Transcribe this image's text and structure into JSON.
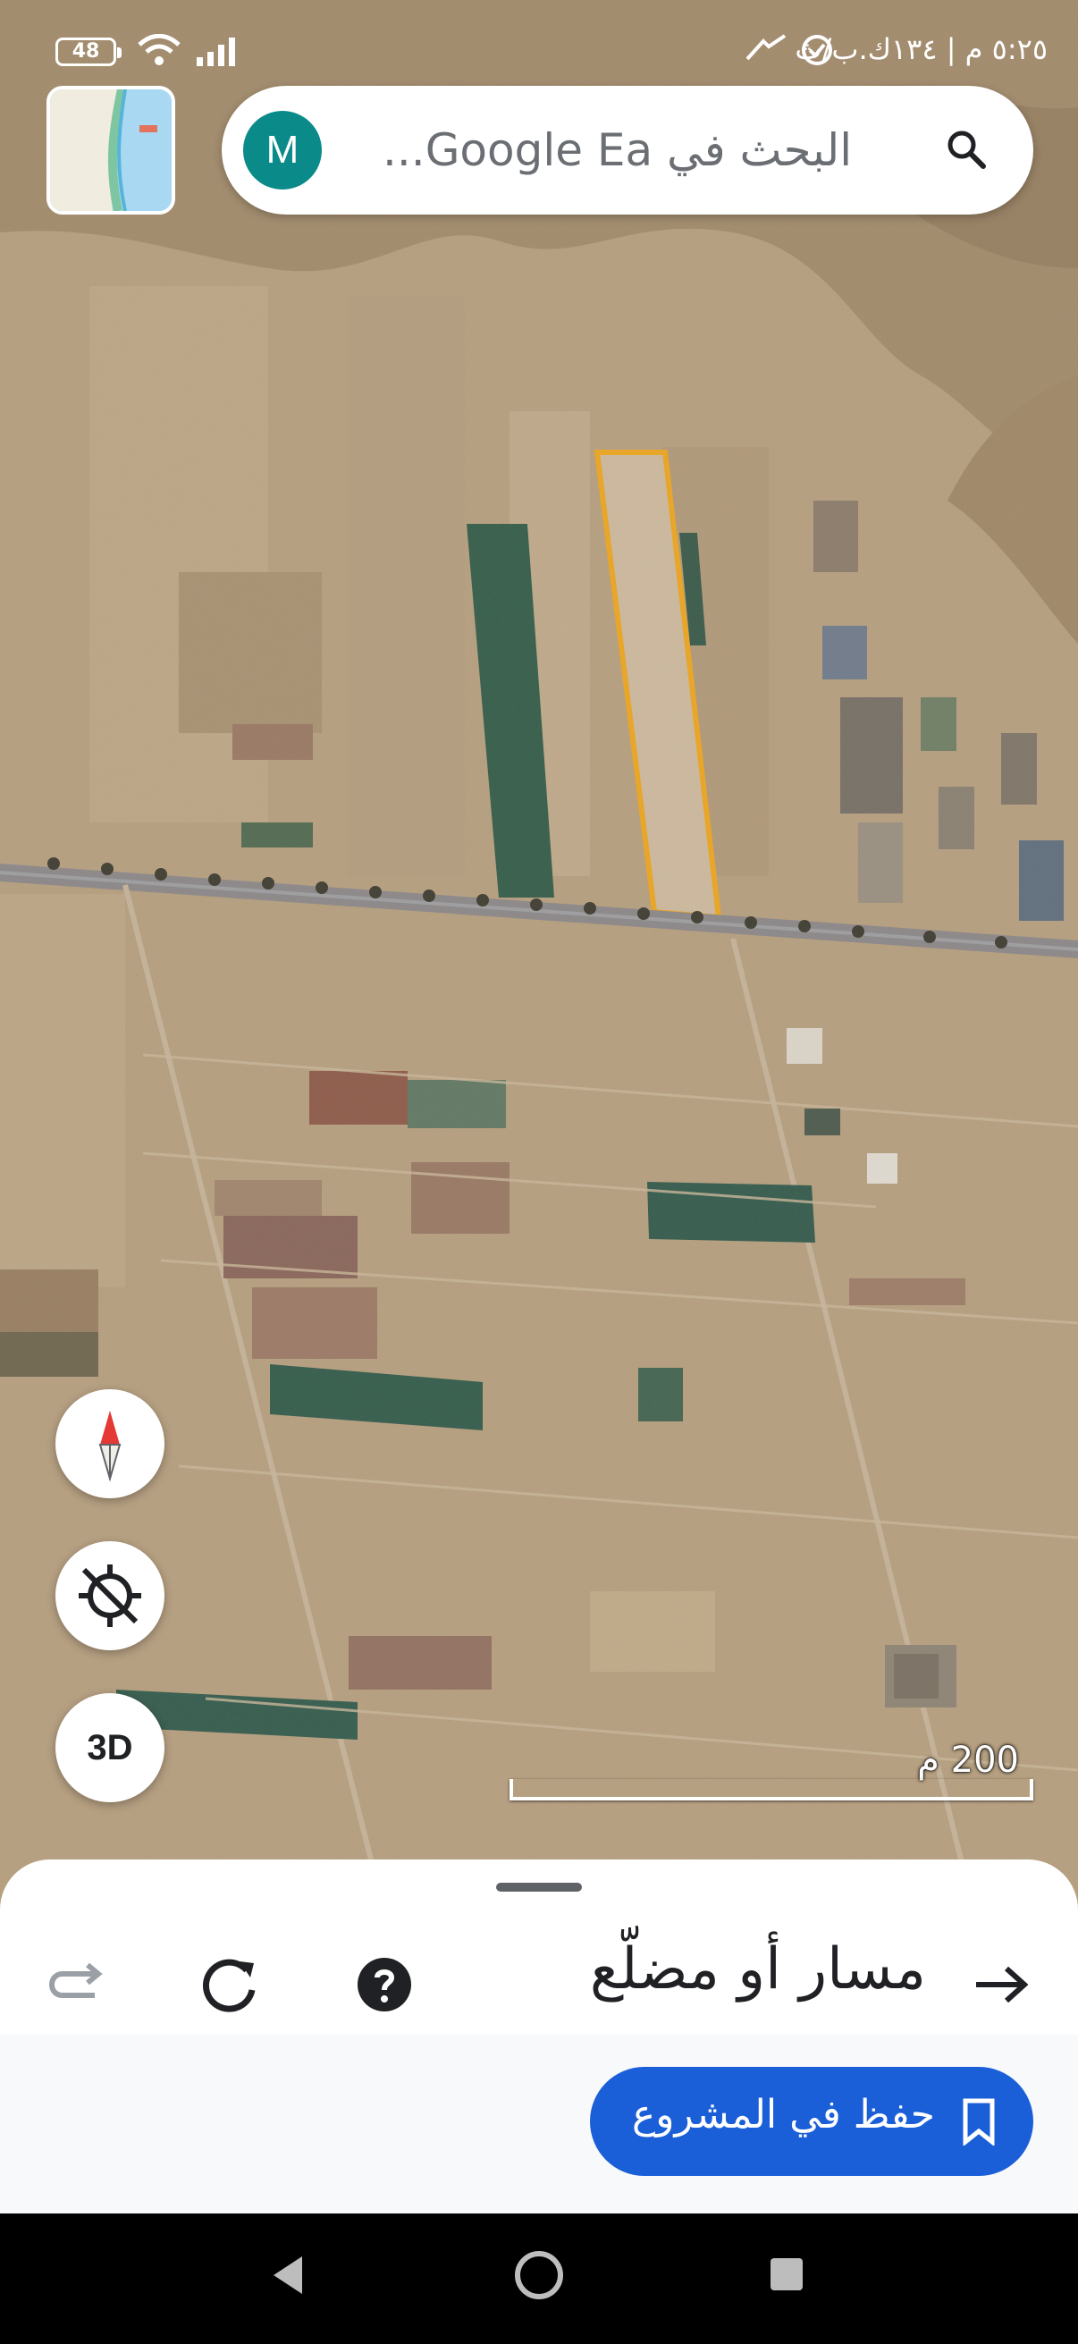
{
  "status_bar": {
    "battery": "48",
    "time": "٥:٢٥ م | ١٣٤ك.ب/ث"
  },
  "search": {
    "avatar_letter": "M",
    "placeholder": "البحث في Google Ea..."
  },
  "map": {
    "scale_label": "200 م",
    "controls": {
      "compass": "compass-icon",
      "location": "location-off-icon",
      "three_d_label": "3D"
    }
  },
  "sheet": {
    "title": "مسار أو مضلّع",
    "save_label": "حفظ في المشروع",
    "tools": [
      "redo-icon",
      "refresh-icon",
      "help-icon",
      "arrow-right-icon"
    ]
  },
  "colors": {
    "accent": "#1b5fd8",
    "highlight": "#f2a91f",
    "avatar": "#0b8a8a"
  }
}
